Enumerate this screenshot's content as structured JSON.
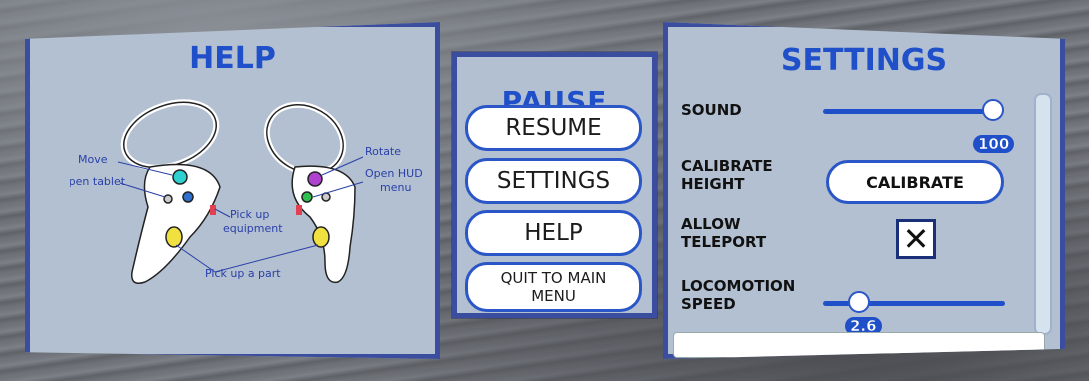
{
  "help": {
    "title": "HELP",
    "labels": {
      "move": "Move",
      "open_tablet": "Open tablet",
      "pick_up_equipment_1": "Pick up",
      "pick_up_equipment_2": "equipment",
      "pick_up_part": "Pick up a part",
      "rotate": "Rotate",
      "open_hud_1": "Open HUD",
      "open_hud_2": "menu"
    }
  },
  "pause": {
    "title": "PAUSE",
    "resume": "RESUME",
    "settings": "SETTINGS",
    "help": "HELP",
    "quit_1": "QUIT TO MAIN",
    "quit_2": "MENU"
  },
  "settings": {
    "title": "SETTINGS",
    "sound_label": "SOUND",
    "sound_value": "100",
    "sound_fraction": 1.0,
    "calibrate_label_1": "CALIBRATE",
    "calibrate_label_2": "HEIGHT",
    "calibrate_button": "CALIBRATE",
    "teleport_label_1": "ALLOW",
    "teleport_label_2": "TELEPORT",
    "teleport_checked": true,
    "teleport_mark": "✕",
    "locomotion_label_1": "LOCOMOTION",
    "locomotion_label_2": "SPEED",
    "locomotion_value": "2.6",
    "locomotion_fraction": 0.2
  },
  "colors": {
    "accent": "#1f4fc9",
    "panel": "#b3c0d1",
    "border": "#3a4d9e"
  }
}
